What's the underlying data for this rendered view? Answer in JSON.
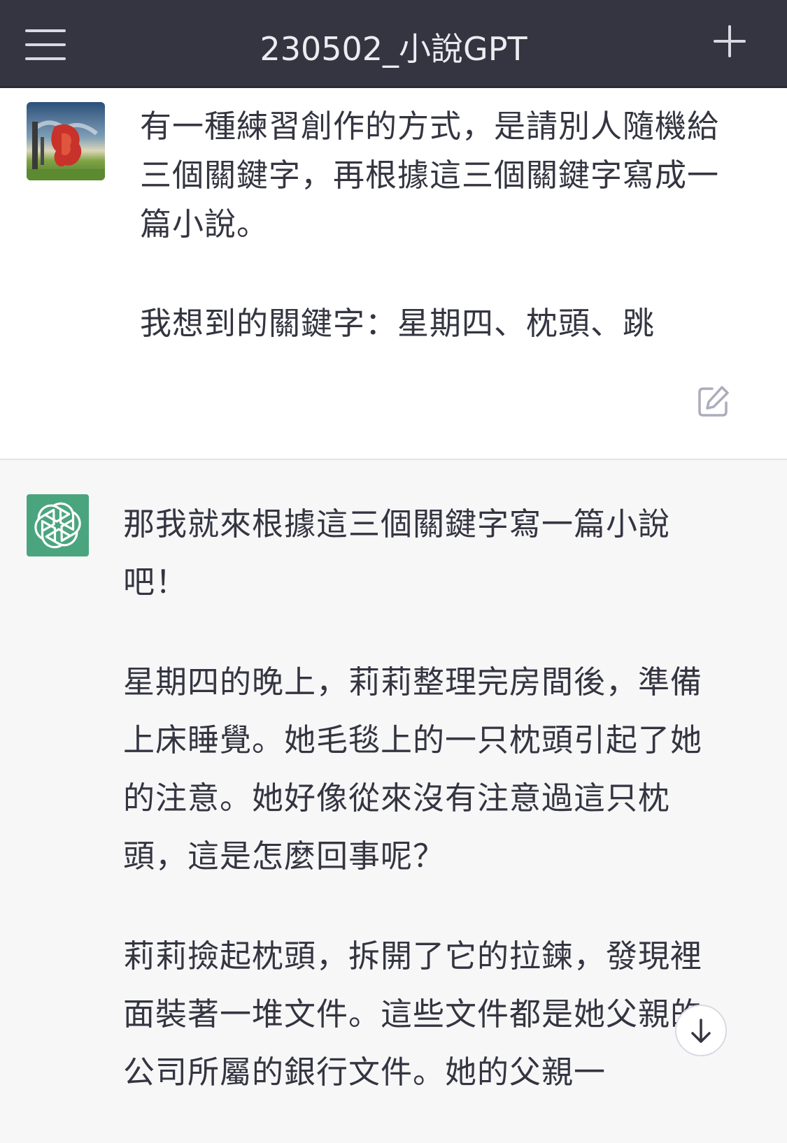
{
  "header": {
    "title": "230502_小說GPT"
  },
  "icons": {
    "menu": "hamburger-menu-icon",
    "new_chat": "plus-icon",
    "edit": "edit-icon",
    "bot": "openai-logo-icon",
    "scroll_down": "arrow-down-icon"
  },
  "colors": {
    "header_bg": "#343541",
    "bot_avatar_bg": "#4aa57f",
    "text": "#343541"
  },
  "user_message": {
    "paragraphs": [
      "有一種練習創作的方式，是請別人隨機給三個關鍵字，再根據這三個關鍵字寫成一篇小說。",
      "我想到的關鍵字：星期四、枕頭、跳"
    ]
  },
  "bot_message": {
    "paragraphs": [
      "那我就來根據這三個關鍵字寫一篇小說吧！",
      "星期四的晚上，莉莉整理完房間後，準備上床睡覺。她毛毯上的一只枕頭引起了她的注意。她好像從來沒有注意過這只枕頭，這是怎麼回事呢？",
      "莉莉撿起枕頭，拆開了它的拉鍊，發現裡面裝著一堆文件。這些文件都是她父親的公司所屬的銀行文件。她的父親一"
    ]
  }
}
